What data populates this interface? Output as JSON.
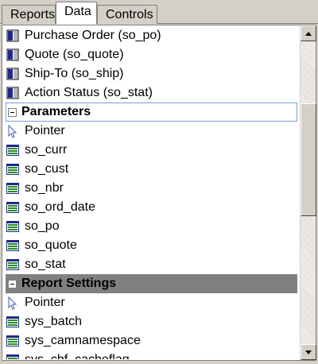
{
  "tabs": [
    {
      "label": "Reports",
      "active": false
    },
    {
      "label": "Data",
      "active": true
    },
    {
      "label": "Controls",
      "active": false
    }
  ],
  "tables": [
    {
      "label": "Purchase Order (so_po)",
      "icon": "table-icon"
    },
    {
      "label": "Quote (so_quote)",
      "icon": "table-icon"
    },
    {
      "label": "Ship-To (so_ship)",
      "icon": "table-icon"
    },
    {
      "label": "Action Status (so_stat)",
      "icon": "table-icon"
    }
  ],
  "parameters": {
    "title": "Parameters",
    "items": [
      {
        "label": "Pointer",
        "icon": "pointer-icon"
      },
      {
        "label": "so_curr",
        "icon": "field-icon"
      },
      {
        "label": "so_cust",
        "icon": "field-icon"
      },
      {
        "label": "so_nbr",
        "icon": "field-icon"
      },
      {
        "label": "so_ord_date",
        "icon": "field-icon"
      },
      {
        "label": "so_po",
        "icon": "field-icon"
      },
      {
        "label": "so_quote",
        "icon": "field-icon"
      },
      {
        "label": "so_stat",
        "icon": "field-icon"
      }
    ]
  },
  "report_settings": {
    "title": "Report Settings",
    "items": [
      {
        "label": "Pointer",
        "icon": "pointer-icon"
      },
      {
        "label": "sys_batch",
        "icon": "field-icon"
      },
      {
        "label": "sys_camnamespace",
        "icon": "field-icon"
      },
      {
        "label": "sys_cbf_cacheflag",
        "icon": "field-icon"
      }
    ]
  },
  "colors": {
    "window_bg": "#d4d0c8",
    "list_bg": "#ffffff",
    "section_focus_border": "#7aa0d6",
    "section_header_gray": "#808080",
    "table_icon_blue": "#1f2a8a",
    "field_icon_green": "#2b8a2b"
  }
}
